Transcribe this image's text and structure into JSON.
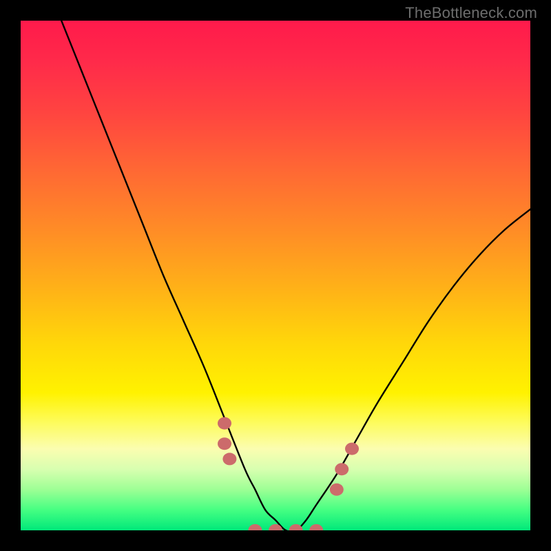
{
  "watermark": "TheBottleneck.com",
  "chart_data": {
    "type": "line",
    "title": "",
    "xlabel": "",
    "ylabel": "",
    "xlim": [
      0,
      100
    ],
    "ylim": [
      0,
      100
    ],
    "grid": false,
    "legend": false,
    "series": [
      {
        "name": "bottleneck-curve",
        "x": [
          8,
          12,
          16,
          20,
          24,
          28,
          32,
          36,
          40,
          44,
          46,
          48,
          50,
          52,
          54,
          56,
          58,
          62,
          66,
          70,
          75,
          80,
          85,
          90,
          95,
          100
        ],
        "y": [
          100,
          90,
          80,
          70,
          60,
          50,
          41,
          32,
          22,
          12,
          8,
          4,
          2,
          0,
          0,
          2,
          5,
          11,
          18,
          25,
          33,
          41,
          48,
          54,
          59,
          63
        ]
      }
    ],
    "markers": {
      "name": "highlight-points",
      "color": "#cc6b6b",
      "points": [
        {
          "x": 40,
          "y": 21
        },
        {
          "x": 40,
          "y": 17
        },
        {
          "x": 41,
          "y": 14
        },
        {
          "x": 46,
          "y": 0
        },
        {
          "x": 50,
          "y": 0
        },
        {
          "x": 54,
          "y": 0
        },
        {
          "x": 58,
          "y": 0
        },
        {
          "x": 62,
          "y": 8
        },
        {
          "x": 63,
          "y": 12
        },
        {
          "x": 65,
          "y": 16
        }
      ]
    },
    "background_gradient": {
      "top": "#ff1a4b",
      "mid": "#ffd60a",
      "bottom": "#00e87a"
    }
  }
}
